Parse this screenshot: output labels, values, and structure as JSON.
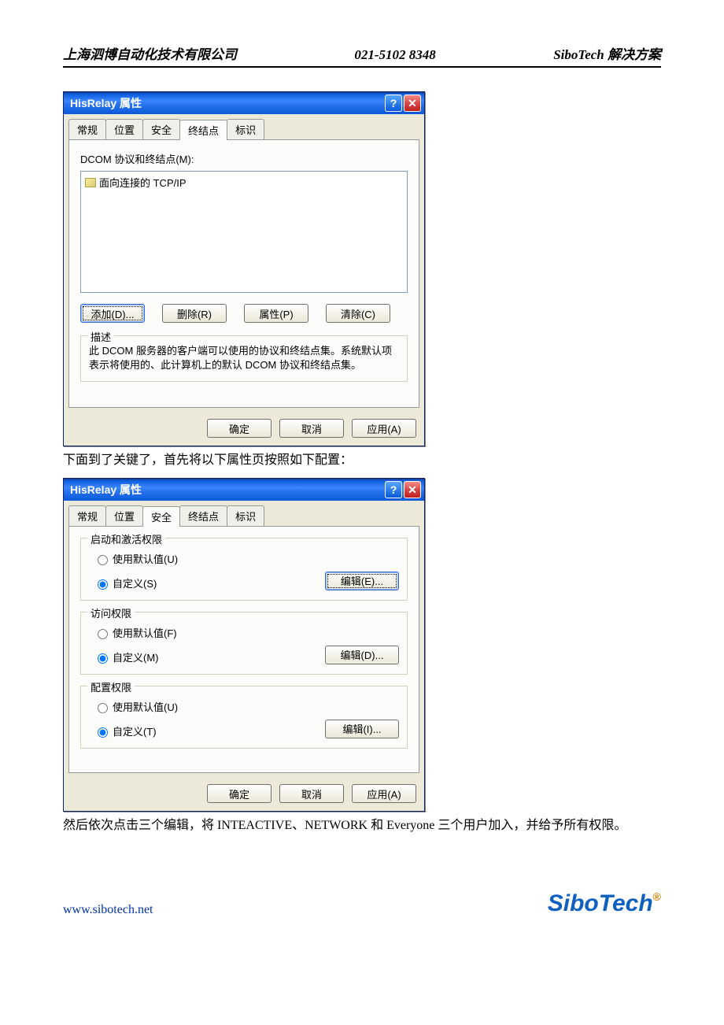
{
  "header": {
    "company": "上海泗博自动化技术有限公司",
    "phone": "021-5102 8348",
    "solution": "SiboTech 解决方案"
  },
  "dialog1": {
    "title": "HisRelay 属性",
    "tabs": [
      "常规",
      "位置",
      "安全",
      "终结点",
      "标识"
    ],
    "active_tab": 3,
    "endpoint_label": "DCOM 协议和终结点(M):",
    "list_item": "面向连接的 TCP/IP",
    "buttons": {
      "add": "添加(D)...",
      "remove": "删除(R)",
      "props": "属性(P)",
      "clear": "清除(C)"
    },
    "desc_group": "描述",
    "description": "此 DCOM 服务器的客户端可以使用的协议和终结点集。系统默认项表示将使用的、此计算机上的默认 DCOM 协议和终结点集。",
    "footer": {
      "ok": "确定",
      "cancel": "取消",
      "apply": "应用(A)"
    }
  },
  "midtext": "下面到了关键了，首先将以下属性页按照如下配置：",
  "dialog2": {
    "title": "HisRelay 属性",
    "tabs": [
      "常规",
      "位置",
      "安全",
      "终结点",
      "标识"
    ],
    "active_tab": 2,
    "group1": {
      "title": "启动和激活权限",
      "opt1": "使用默认值(U)",
      "opt2": "自定义(S)",
      "edit": "编辑(E)..."
    },
    "group2": {
      "title": "访问权限",
      "opt1": "使用默认值(F)",
      "opt2": "自定义(M)",
      "edit": "编辑(D)..."
    },
    "group3": {
      "title": "配置权限",
      "opt1": "使用默认值(U)",
      "opt2": "自定义(T)",
      "edit": "编辑(I)..."
    },
    "footer": {
      "ok": "确定",
      "cancel": "取消",
      "apply": "应用(A)"
    }
  },
  "tailtext": "然后依次点击三个编辑，将 INTEACTIVE、NETWORK 和 Everyone 三个用户加入，并给予所有权限。",
  "footer": {
    "url": "www.sibotech.net",
    "logo": "SiboTech"
  }
}
